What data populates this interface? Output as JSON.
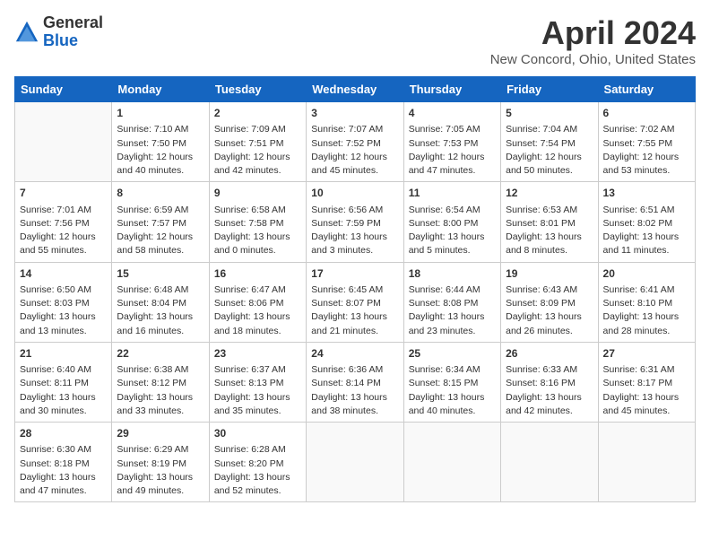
{
  "header": {
    "logo_general": "General",
    "logo_blue": "Blue",
    "title": "April 2024",
    "subtitle": "New Concord, Ohio, United States"
  },
  "days_of_week": [
    "Sunday",
    "Monday",
    "Tuesday",
    "Wednesday",
    "Thursday",
    "Friday",
    "Saturday"
  ],
  "weeks": [
    [
      {
        "num": "",
        "data": ""
      },
      {
        "num": "1",
        "data": "Sunrise: 7:10 AM\nSunset: 7:50 PM\nDaylight: 12 hours\nand 40 minutes."
      },
      {
        "num": "2",
        "data": "Sunrise: 7:09 AM\nSunset: 7:51 PM\nDaylight: 12 hours\nand 42 minutes."
      },
      {
        "num": "3",
        "data": "Sunrise: 7:07 AM\nSunset: 7:52 PM\nDaylight: 12 hours\nand 45 minutes."
      },
      {
        "num": "4",
        "data": "Sunrise: 7:05 AM\nSunset: 7:53 PM\nDaylight: 12 hours\nand 47 minutes."
      },
      {
        "num": "5",
        "data": "Sunrise: 7:04 AM\nSunset: 7:54 PM\nDaylight: 12 hours\nand 50 minutes."
      },
      {
        "num": "6",
        "data": "Sunrise: 7:02 AM\nSunset: 7:55 PM\nDaylight: 12 hours\nand 53 minutes."
      }
    ],
    [
      {
        "num": "7",
        "data": "Sunrise: 7:01 AM\nSunset: 7:56 PM\nDaylight: 12 hours\nand 55 minutes."
      },
      {
        "num": "8",
        "data": "Sunrise: 6:59 AM\nSunset: 7:57 PM\nDaylight: 12 hours\nand 58 minutes."
      },
      {
        "num": "9",
        "data": "Sunrise: 6:58 AM\nSunset: 7:58 PM\nDaylight: 13 hours\nand 0 minutes."
      },
      {
        "num": "10",
        "data": "Sunrise: 6:56 AM\nSunset: 7:59 PM\nDaylight: 13 hours\nand 3 minutes."
      },
      {
        "num": "11",
        "data": "Sunrise: 6:54 AM\nSunset: 8:00 PM\nDaylight: 13 hours\nand 5 minutes."
      },
      {
        "num": "12",
        "data": "Sunrise: 6:53 AM\nSunset: 8:01 PM\nDaylight: 13 hours\nand 8 minutes."
      },
      {
        "num": "13",
        "data": "Sunrise: 6:51 AM\nSunset: 8:02 PM\nDaylight: 13 hours\nand 11 minutes."
      }
    ],
    [
      {
        "num": "14",
        "data": "Sunrise: 6:50 AM\nSunset: 8:03 PM\nDaylight: 13 hours\nand 13 minutes."
      },
      {
        "num": "15",
        "data": "Sunrise: 6:48 AM\nSunset: 8:04 PM\nDaylight: 13 hours\nand 16 minutes."
      },
      {
        "num": "16",
        "data": "Sunrise: 6:47 AM\nSunset: 8:06 PM\nDaylight: 13 hours\nand 18 minutes."
      },
      {
        "num": "17",
        "data": "Sunrise: 6:45 AM\nSunset: 8:07 PM\nDaylight: 13 hours\nand 21 minutes."
      },
      {
        "num": "18",
        "data": "Sunrise: 6:44 AM\nSunset: 8:08 PM\nDaylight: 13 hours\nand 23 minutes."
      },
      {
        "num": "19",
        "data": "Sunrise: 6:43 AM\nSunset: 8:09 PM\nDaylight: 13 hours\nand 26 minutes."
      },
      {
        "num": "20",
        "data": "Sunrise: 6:41 AM\nSunset: 8:10 PM\nDaylight: 13 hours\nand 28 minutes."
      }
    ],
    [
      {
        "num": "21",
        "data": "Sunrise: 6:40 AM\nSunset: 8:11 PM\nDaylight: 13 hours\nand 30 minutes."
      },
      {
        "num": "22",
        "data": "Sunrise: 6:38 AM\nSunset: 8:12 PM\nDaylight: 13 hours\nand 33 minutes."
      },
      {
        "num": "23",
        "data": "Sunrise: 6:37 AM\nSunset: 8:13 PM\nDaylight: 13 hours\nand 35 minutes."
      },
      {
        "num": "24",
        "data": "Sunrise: 6:36 AM\nSunset: 8:14 PM\nDaylight: 13 hours\nand 38 minutes."
      },
      {
        "num": "25",
        "data": "Sunrise: 6:34 AM\nSunset: 8:15 PM\nDaylight: 13 hours\nand 40 minutes."
      },
      {
        "num": "26",
        "data": "Sunrise: 6:33 AM\nSunset: 8:16 PM\nDaylight: 13 hours\nand 42 minutes."
      },
      {
        "num": "27",
        "data": "Sunrise: 6:31 AM\nSunset: 8:17 PM\nDaylight: 13 hours\nand 45 minutes."
      }
    ],
    [
      {
        "num": "28",
        "data": "Sunrise: 6:30 AM\nSunset: 8:18 PM\nDaylight: 13 hours\nand 47 minutes."
      },
      {
        "num": "29",
        "data": "Sunrise: 6:29 AM\nSunset: 8:19 PM\nDaylight: 13 hours\nand 49 minutes."
      },
      {
        "num": "30",
        "data": "Sunrise: 6:28 AM\nSunset: 8:20 PM\nDaylight: 13 hours\nand 52 minutes."
      },
      {
        "num": "",
        "data": ""
      },
      {
        "num": "",
        "data": ""
      },
      {
        "num": "",
        "data": ""
      },
      {
        "num": "",
        "data": ""
      }
    ]
  ]
}
